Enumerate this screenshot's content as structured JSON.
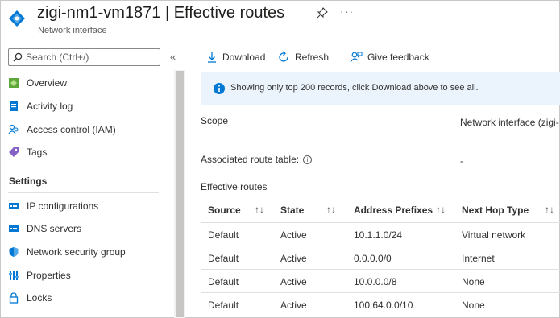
{
  "header": {
    "title": "zigi-nm1-vm1871 | Effective routes",
    "subtitle": "Network interface",
    "more_label": "···"
  },
  "sidebar": {
    "search_placeholder": "Search (Ctrl+/)",
    "collapse_label": "«",
    "items": [
      {
        "label": "Overview",
        "icon": "overview-icon"
      },
      {
        "label": "Activity log",
        "icon": "activity-log-icon"
      },
      {
        "label": "Access control (IAM)",
        "icon": "access-control-icon"
      },
      {
        "label": "Tags",
        "icon": "tag-icon"
      }
    ],
    "settings_section": "Settings",
    "settings_items": [
      {
        "label": "IP configurations",
        "icon": "ip-config-icon"
      },
      {
        "label": "DNS servers",
        "icon": "dns-server-icon"
      },
      {
        "label": "Network security group",
        "icon": "shield-icon"
      },
      {
        "label": "Properties",
        "icon": "properties-icon"
      },
      {
        "label": "Locks",
        "icon": "lock-icon"
      }
    ]
  },
  "toolbar": {
    "download_label": "Download",
    "refresh_label": "Refresh",
    "feedback_label": "Give feedback"
  },
  "info_banner": "Showing only top 200 records, click Download above to see all.",
  "details": {
    "scope_label": "Scope",
    "scope_value": "Network interface (zigi-",
    "route_table_label": "Associated route table:",
    "route_table_value": "-",
    "section_title": "Effective routes"
  },
  "table": {
    "columns": [
      "Source",
      "State",
      "Address Prefixes",
      "Next Hop Type"
    ],
    "sort_glyph": "↑↓",
    "rows": [
      [
        "Default",
        "Active",
        "10.1.1.0/24",
        "Virtual network"
      ],
      [
        "Default",
        "Active",
        "0.0.0.0/0",
        "Internet"
      ],
      [
        "Default",
        "Active",
        "10.0.0.0/8",
        "None"
      ],
      [
        "Default",
        "Active",
        "100.64.0.0/10",
        "None"
      ]
    ]
  },
  "colors": {
    "accent": "#0078d4",
    "info_background": "#ebf3fc"
  }
}
